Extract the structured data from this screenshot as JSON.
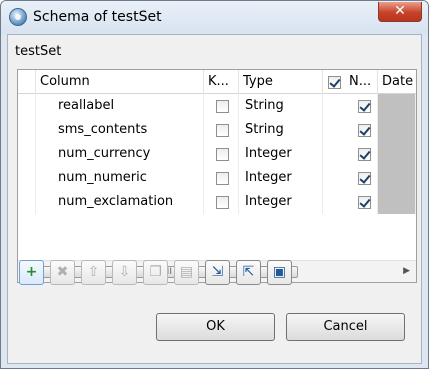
{
  "window": {
    "title": "Schema of testSet",
    "close_glyph": "✕"
  },
  "table_name": "testSet",
  "grid": {
    "headers": {
      "column": "Column",
      "key": "K...",
      "type": "Type",
      "nullable_check": true,
      "nullable": "N...",
      "date": "Date"
    },
    "rows": [
      {
        "column": "reallabel",
        "key": false,
        "type": "String",
        "nullable": true
      },
      {
        "column": "sms_contents",
        "key": false,
        "type": "String",
        "nullable": true
      },
      {
        "column": "num_currency",
        "key": false,
        "type": "Integer",
        "nullable": true
      },
      {
        "column": "num_numeric",
        "key": false,
        "type": "Integer",
        "nullable": true
      },
      {
        "column": "num_exclamation",
        "key": false,
        "type": "Integer",
        "nullable": true
      }
    ],
    "scrollbar_thumb_glyph": "III"
  },
  "toolbar": {
    "buttons": [
      {
        "icon": "add-icon",
        "glyph": "+",
        "enabled": true
      },
      {
        "icon": "remove-icon",
        "glyph": "✖",
        "enabled": false
      },
      {
        "icon": "move-up-icon",
        "glyph": "⇧",
        "enabled": false
      },
      {
        "icon": "move-down-icon",
        "glyph": "⇩",
        "enabled": false
      },
      {
        "icon": "copy-icon",
        "glyph": "❐",
        "enabled": false
      },
      {
        "icon": "paste-icon",
        "glyph": "▤",
        "enabled": false
      },
      {
        "icon": "import-icon",
        "glyph": "⇲",
        "enabled": true
      },
      {
        "icon": "export-icon",
        "glyph": "⇱",
        "enabled": true
      },
      {
        "icon": "save-icon",
        "glyph": "▣",
        "enabled": true
      }
    ]
  },
  "buttons": {
    "ok": "OK",
    "cancel": "Cancel"
  }
}
